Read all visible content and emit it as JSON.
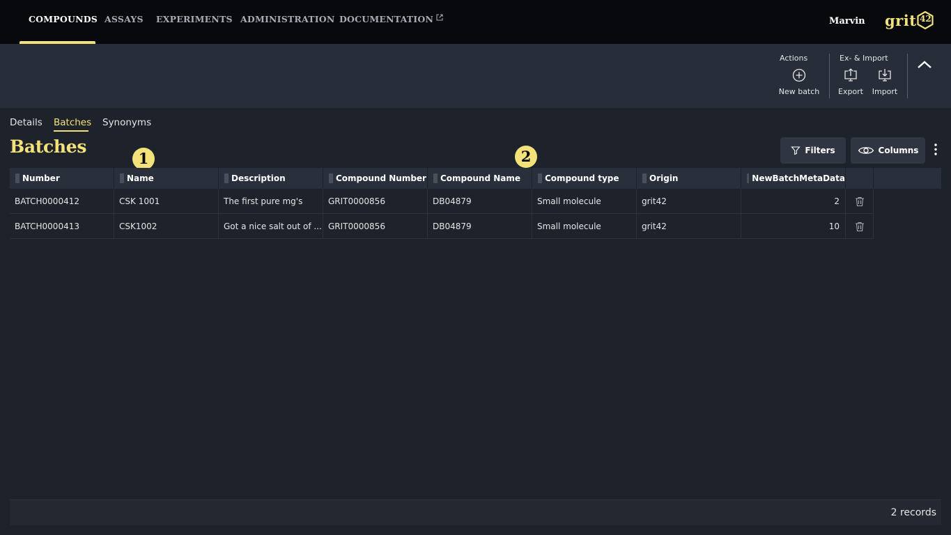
{
  "nav": {
    "items": [
      {
        "label": "COMPOUNDS"
      },
      {
        "label": "ASSAYS"
      },
      {
        "label": "EXPERIMENTS"
      },
      {
        "label": "ADMINISTRATION"
      },
      {
        "label": "DOCUMENTATION"
      }
    ],
    "active": "COMPOUNDS",
    "user": "Marvin",
    "logo_text": "grit",
    "logo_number": "42"
  },
  "toolbar": {
    "actions_label": "Actions",
    "new_batch_label": "New batch",
    "ex_import_label": "Ex- & Import",
    "export_label": "Export",
    "import_label": "Import"
  },
  "tabs": [
    {
      "label": "Details"
    },
    {
      "label": "Batches"
    },
    {
      "label": "Synonyms"
    }
  ],
  "active_tab": "Batches",
  "page_title": "Batches",
  "markers": [
    "1",
    "2"
  ],
  "grid_actions": {
    "filters_label": "Filters",
    "columns_label": "Columns"
  },
  "table": {
    "columns": [
      "Number",
      "Name",
      "Description",
      "Compound Number",
      "Compound Name",
      "Compound type",
      "Origin",
      "NewBatchMetaData"
    ],
    "rows": [
      {
        "number": "BATCH0000412",
        "name": "CSK 1001",
        "description": "The first pure mg's",
        "compound_number": "GRIT0000856",
        "compound_name": "DB04879",
        "compound_type": "Small molecule",
        "origin": "grit42",
        "meta": "2"
      },
      {
        "number": "BATCH0000413",
        "name": "CSK1002",
        "description": "Got a nice salt out of ...",
        "compound_number": "GRIT0000856",
        "compound_name": "DB04879",
        "compound_type": "Small molecule",
        "origin": "grit42",
        "meta": "10"
      }
    ],
    "records_label": "2 records"
  },
  "colors": {
    "accent": "#f3e27a",
    "topbar": "#07090d",
    "toolbar": "#282e39",
    "background": "#1d222b"
  }
}
